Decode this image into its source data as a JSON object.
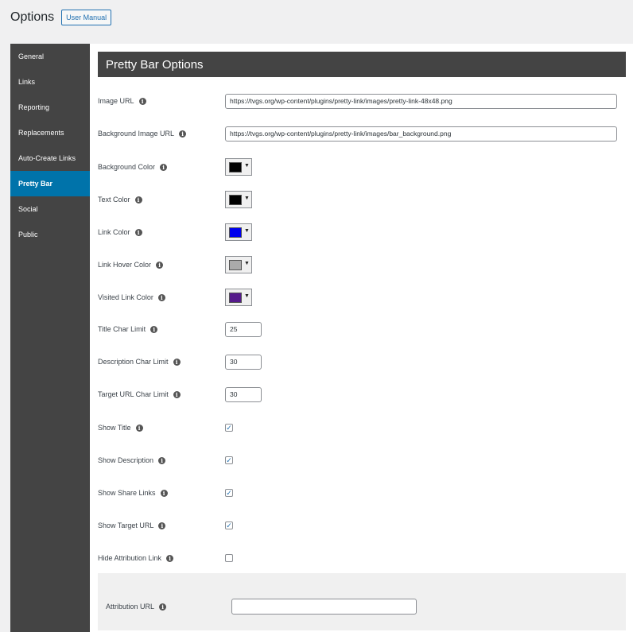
{
  "page": {
    "title": "Options",
    "user_manual_label": "User Manual"
  },
  "sidebar": {
    "items": [
      {
        "label": "General",
        "active": false
      },
      {
        "label": "Links",
        "active": false
      },
      {
        "label": "Reporting",
        "active": false
      },
      {
        "label": "Replacements",
        "active": false
      },
      {
        "label": "Auto-Create Links",
        "active": false
      },
      {
        "label": "Pretty Bar",
        "active": true
      },
      {
        "label": "Social",
        "active": false
      },
      {
        "label": "Public",
        "active": false
      }
    ]
  },
  "section": {
    "title": "Pretty Bar Options",
    "info_icon": "info-icon",
    "fields": {
      "image_url": {
        "label": "Image URL",
        "value": "https://tvgs.org/wp-content/plugins/pretty-link/images/pretty-link-48x48.png"
      },
      "background_image_url": {
        "label": "Background Image URL",
        "value": "https://tvgs.org/wp-content/plugins/pretty-link/images/bar_background.png"
      },
      "background_color": {
        "label": "Background Color",
        "color": "#000000"
      },
      "text_color": {
        "label": "Text Color",
        "color": "#000000"
      },
      "link_color": {
        "label": "Link Color",
        "color": "#0000ee"
      },
      "link_hover_color": {
        "label": "Link Hover Color",
        "color": "#aaaaaa"
      },
      "visited_link_color": {
        "label": "Visited Link Color",
        "color": "#551a8b"
      },
      "title_char_limit": {
        "label": "Title Char Limit",
        "value": "25"
      },
      "description_char_limit": {
        "label": "Description Char Limit",
        "value": "30"
      },
      "target_url_char_limit": {
        "label": "Target URL Char Limit",
        "value": "30"
      },
      "show_title": {
        "label": "Show Title",
        "checked": true
      },
      "show_description": {
        "label": "Show Description",
        "checked": true
      },
      "show_share_links": {
        "label": "Show Share Links",
        "checked": true
      },
      "show_target_url": {
        "label": "Show Target URL",
        "checked": true
      },
      "hide_attribution_link": {
        "label": "Hide Attribution Link",
        "checked": false
      },
      "attribution_url": {
        "label": "Attribution URL",
        "value": ""
      }
    },
    "check_glyph": "✓",
    "info_glyph": "i",
    "caret_glyph": "▼"
  }
}
